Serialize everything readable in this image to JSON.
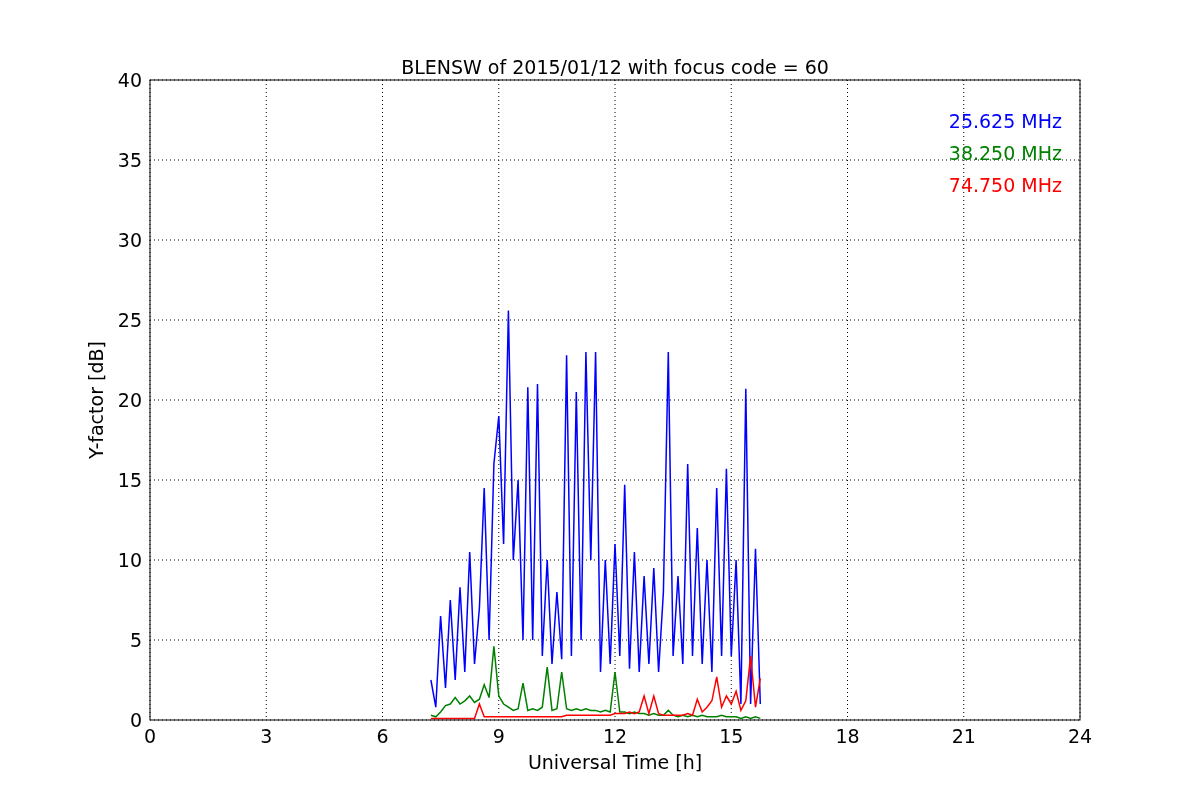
{
  "chart_data": {
    "type": "line",
    "title": "BLENSW of 2015/01/12 with focus code = 60",
    "xlabel": "Universal Time [h]",
    "ylabel": "Y-factor [dB]",
    "x": [
      7.25,
      7.375,
      7.5,
      7.625,
      7.75,
      7.875,
      8.0,
      8.125,
      8.25,
      8.375,
      8.5,
      8.625,
      8.75,
      8.875,
      9.0,
      9.125,
      9.25,
      9.375,
      9.5,
      9.625,
      9.75,
      9.875,
      10.0,
      10.125,
      10.25,
      10.375,
      10.5,
      10.625,
      10.75,
      10.875,
      11.0,
      11.125,
      11.25,
      11.375,
      11.5,
      11.625,
      11.75,
      11.875,
      12.0,
      12.125,
      12.25,
      12.375,
      12.5,
      12.625,
      12.75,
      12.875,
      13.0,
      13.125,
      13.25,
      13.375,
      13.5,
      13.625,
      13.75,
      13.875,
      14.0,
      14.125,
      14.25,
      14.375,
      14.5,
      14.625,
      14.75,
      14.875,
      15.0,
      15.125,
      15.25,
      15.375,
      15.5,
      15.625,
      15.75
    ],
    "series": [
      {
        "name": "25.625 MHz",
        "color": "#0000ff",
        "values": [
          2.5,
          0.8,
          6.5,
          2,
          7.5,
          2.5,
          8.3,
          3,
          10.5,
          3.5,
          7,
          14.5,
          5,
          16,
          19,
          11,
          25.6,
          10,
          15,
          5,
          20.8,
          5,
          21,
          4,
          10,
          3.5,
          8,
          3.8,
          22.8,
          4,
          20.5,
          5,
          23,
          10,
          23,
          3,
          10,
          3.5,
          11,
          4,
          14.7,
          3.2,
          10.5,
          3,
          9,
          3.5,
          9.5,
          3,
          8,
          23,
          4,
          9,
          3.5,
          16,
          4,
          12,
          3.5,
          10,
          3,
          14.5,
          4,
          15.7,
          4,
          10,
          1,
          20.7,
          1,
          10.7,
          1
        ]
      },
      {
        "name": "38.250 MHz",
        "color": "#008000",
        "values": [
          0.3,
          0.2,
          0.5,
          0.9,
          1.0,
          1.4,
          1.0,
          1.2,
          1.5,
          1.1,
          1.3,
          2.2,
          1.4,
          4.6,
          1.5,
          1.0,
          0.8,
          0.6,
          0.7,
          2.3,
          0.6,
          0.7,
          0.6,
          0.8,
          3.3,
          0.6,
          0.7,
          3.0,
          0.7,
          0.6,
          0.7,
          0.6,
          0.7,
          0.6,
          0.6,
          0.5,
          0.6,
          0.5,
          3.0,
          0.5,
          0.5,
          0.4,
          0.5,
          0.4,
          0.4,
          0.3,
          0.4,
          0.3,
          0.3,
          0.6,
          0.3,
          0.2,
          0.3,
          0.2,
          0.3,
          0.2,
          0.3,
          0.2,
          0.2,
          0.2,
          0.3,
          0.2,
          0.2,
          0.2,
          0.1,
          0.2,
          0.1,
          0.2,
          0.1
        ]
      },
      {
        "name": "74.750 MHz",
        "color": "#ff0000",
        "values": [
          0.1,
          0.1,
          0.1,
          0.1,
          0.1,
          0.1,
          0.1,
          0.1,
          0.1,
          0.1,
          1.0,
          0.2,
          0.2,
          0.2,
          0.2,
          0.2,
          0.2,
          0.2,
          0.2,
          0.2,
          0.2,
          0.2,
          0.2,
          0.2,
          0.2,
          0.2,
          0.2,
          0.2,
          0.3,
          0.3,
          0.3,
          0.3,
          0.3,
          0.3,
          0.3,
          0.3,
          0.3,
          0.3,
          0.4,
          0.4,
          0.4,
          0.5,
          0.4,
          0.5,
          1.5,
          0.4,
          1.5,
          0.4,
          0.3,
          0.3,
          0.3,
          0.3,
          0.3,
          0.4,
          0.3,
          1.3,
          0.5,
          0.8,
          1.2,
          2.7,
          0.8,
          1.5,
          1.0,
          1.8,
          0.6,
          1.2,
          4.0,
          0.8,
          2.6
        ]
      }
    ],
    "grid": true,
    "xlim": [
      0,
      24
    ],
    "ylim": [
      0,
      40
    ],
    "xticks": [
      0,
      3,
      6,
      9,
      12,
      15,
      18,
      21,
      24
    ],
    "yticks": [
      0,
      5,
      10,
      15,
      20,
      25,
      30,
      35,
      40
    ]
  }
}
